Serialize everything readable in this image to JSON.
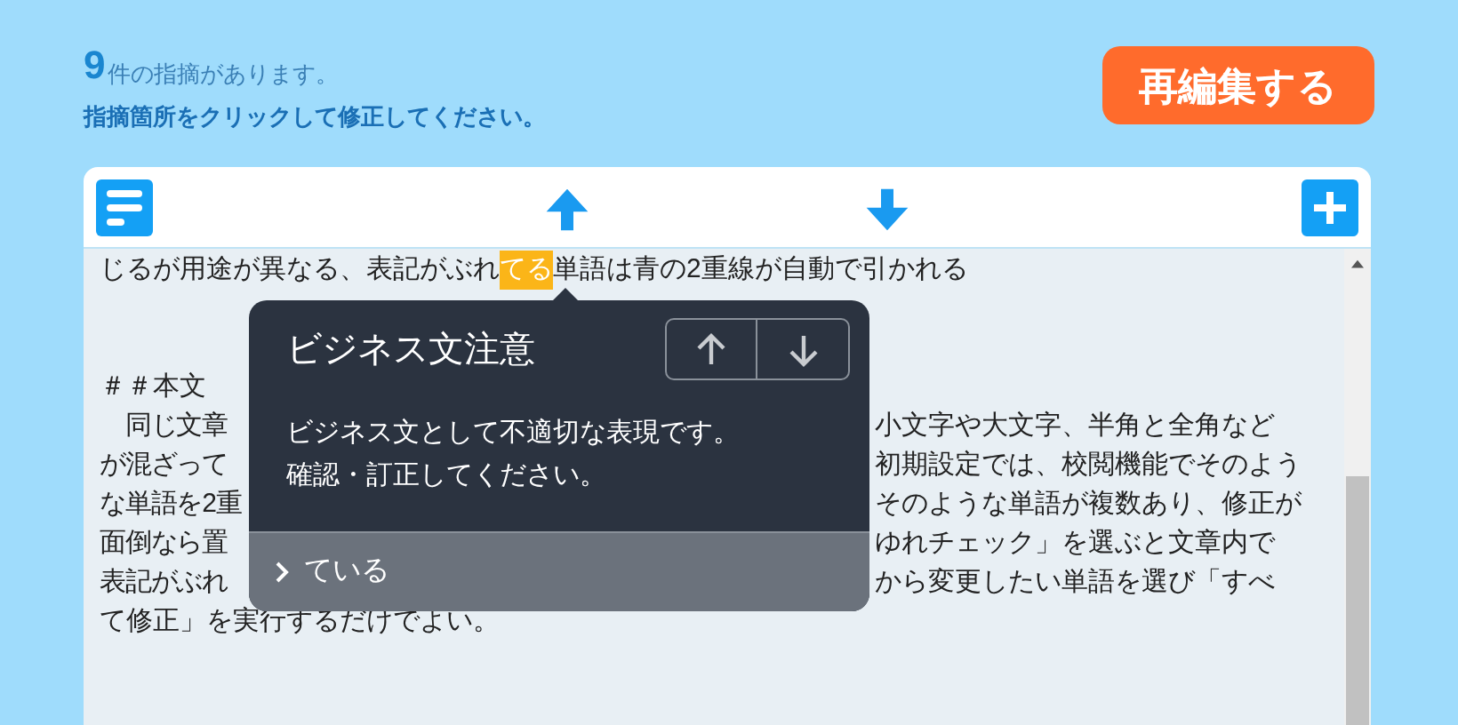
{
  "header": {
    "count": "9",
    "count_suffix": "件の指摘があります。",
    "instruction": "指摘箇所をクリックして修正してください。"
  },
  "reedit_button": "再編集する",
  "editor": {
    "lines": [
      {
        "kind": "highlight",
        "before": "じるが用途が異なる、表記がぶれ",
        "highlight": "てる",
        "after": "単語は青の2重線が自動で引かれる"
      },
      {
        "kind": "blank"
      },
      {
        "kind": "blank"
      },
      {
        "kind": "text",
        "text": "＃＃本文"
      },
      {
        "kind": "split",
        "left": "　同じ文章",
        "right": "小文字や大文字、半角と全角など"
      },
      {
        "kind": "split",
        "left": "が混ざって",
        "right": "初期設定では、校閲機能でそのよう"
      },
      {
        "kind": "split",
        "left": "な単語を2重",
        "right": "そのような単語が複数あり、修正が"
      },
      {
        "kind": "split",
        "left": "面倒なら置",
        "right": "ゆれチェック」を選ぶと文章内で"
      },
      {
        "kind": "split",
        "left": "表記がぶれ",
        "right": "から変更したい単語を選び「すべ"
      },
      {
        "kind": "text",
        "text": "て修正」を実行するだけでよい。"
      }
    ]
  },
  "popup": {
    "title": "ビジネス文注意",
    "message": [
      "ビジネス文として不適切な表現です。",
      "確認・訂正してください。"
    ],
    "suggestion": "ている"
  }
}
